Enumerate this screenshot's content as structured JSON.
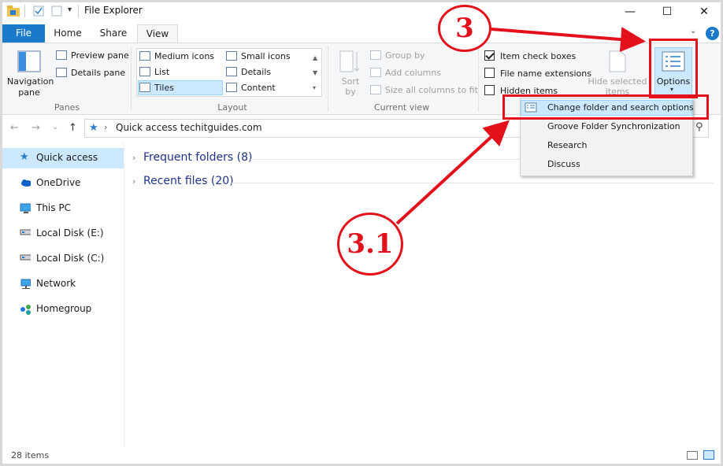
{
  "window": {
    "title": "File Explorer",
    "minimize": "—",
    "maximize": "☐",
    "close": "✕"
  },
  "tabs": [
    "File",
    "Home",
    "Share",
    "View"
  ],
  "active_tab": "View",
  "ribbon": {
    "panes": {
      "label": "Panes",
      "navigation_pane": "Navigation",
      "navigation_pane_2": "pane",
      "preview_pane": "Preview pane",
      "details_pane": "Details pane"
    },
    "layout": {
      "label": "Layout",
      "items": [
        "Medium icons",
        "Small icons",
        "List",
        "Details",
        "Tiles",
        "Content"
      ],
      "selected": "Tiles"
    },
    "current_view": {
      "label": "Current view",
      "sort_by": "Sort",
      "sort_by_2": "by",
      "group_by": "Group by",
      "add_columns": "Add columns",
      "size_all_columns": "Size all columns to fit"
    },
    "show_hide": {
      "item_check_boxes": "Item check boxes",
      "item_check_boxes_checked": true,
      "file_name_extensions": "File name extensions",
      "hidden_items": "Hidden items",
      "hide_selected": "Hide selected",
      "hide_selected_2": "items"
    },
    "options": "Options"
  },
  "address_bar": {
    "path": "Quick access techitguides.com",
    "back": "←",
    "forward": "→",
    "recent": "⌄",
    "up": "↑"
  },
  "nav_pane": {
    "items": [
      "Quick access",
      "OneDrive",
      "This PC",
      "Local Disk  (E:)",
      "Local Disk  (C:)",
      "Network",
      "Homegroup"
    ],
    "selected": "Quick access"
  },
  "content": {
    "sections": [
      "Frequent folders (8)",
      "Recent files (20)"
    ]
  },
  "options_menu": {
    "items": [
      "Change folder and search options",
      "Groove Folder Synchronization",
      "Research",
      "Discuss"
    ]
  },
  "annotations": {
    "step_3": "3",
    "step_3_1": "3.1",
    "color": "#e3111c"
  },
  "status_bar": {
    "item_count": "28 items"
  }
}
